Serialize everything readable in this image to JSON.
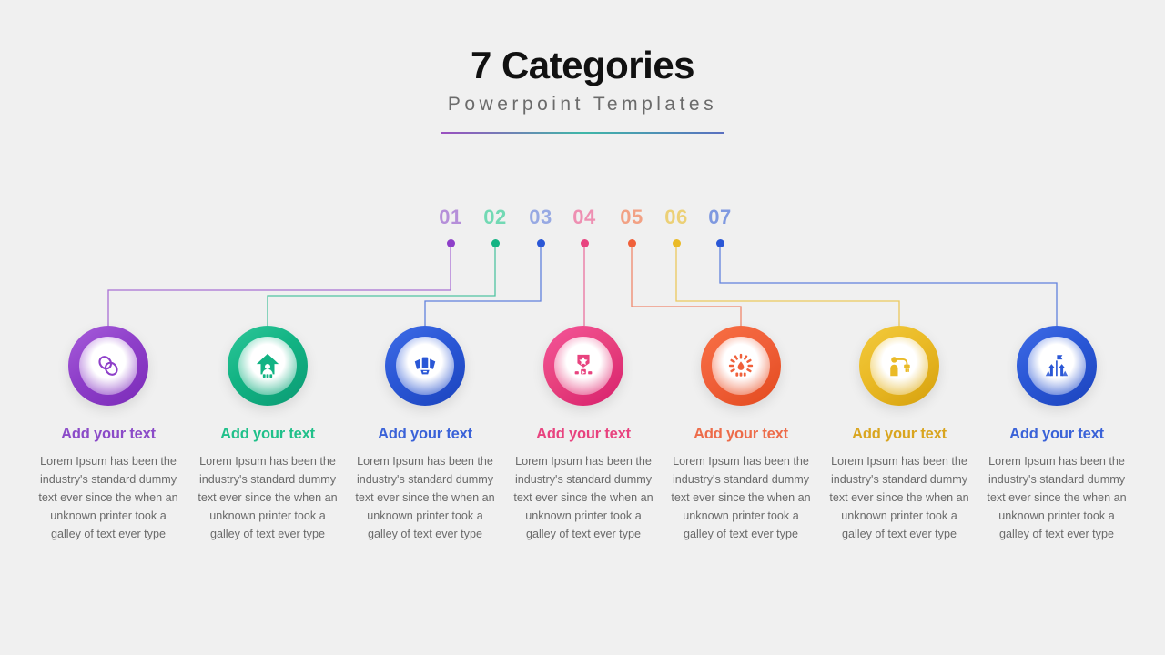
{
  "header": {
    "title": "7 Categories",
    "subtitle": "Powerpoint Templates",
    "rule_gradient": [
      "#9b4fc0",
      "#3fb7a8",
      "#5a6fc0"
    ]
  },
  "categories": [
    {
      "number": "01",
      "number_color": "#b58fd9",
      "accent": "#8e3fc9",
      "ring_light": "#a75ddb",
      "ring_dark": "#7b2bb8",
      "title": "Add your text",
      "title_color": "#8b4bc8",
      "body": "Lorem Ipsum has been the industry's standard dummy text ever since the when an unknown printer took a galley of text ever type",
      "icon": "chain-link-icon"
    },
    {
      "number": "02",
      "number_color": "#72d9b4",
      "accent": "#12b383",
      "ring_light": "#2ec79a",
      "ring_dark": "#0c9a74",
      "title": "Add your text",
      "title_color": "#20c08a",
      "body": "Lorem Ipsum has been the industry's standard dummy text ever since the when an unknown printer took a galley of text ever type",
      "icon": "home-family-icon"
    },
    {
      "number": "03",
      "number_color": "#97a9e3",
      "accent": "#2a57d6",
      "ring_light": "#3f6ce6",
      "ring_dark": "#1c44bd",
      "title": "Add your text",
      "title_color": "#3a62d8",
      "body": "Lorem Ipsum has been the industry's standard dummy text ever since the when an unknown printer took a galley of text ever type",
      "icon": "toolbox-icon"
    },
    {
      "number": "04",
      "number_color": "#ee8fb2",
      "accent": "#e8437f",
      "ring_light": "#f4549a",
      "ring_dark": "#d71f6d",
      "title": "Add your text",
      "title_color": "#e8437f",
      "body": "Lorem Ipsum has been the industry's standard dummy text ever since the when an unknown printer took a galley of text ever type",
      "icon": "award-badge-icon"
    },
    {
      "number": "05",
      "number_color": "#f2a184",
      "accent": "#f0603a",
      "ring_light": "#f87043",
      "ring_dark": "#e34a1d",
      "title": "Add your text",
      "title_color": "#ed6c4a",
      "body": "Lorem Ipsum has been the industry's standard dummy text ever since the when an unknown printer took a galley of text ever type",
      "icon": "gauge-icon"
    },
    {
      "number": "06",
      "number_color": "#ecd076",
      "accent": "#eaba26",
      "ring_light": "#f2ca3d",
      "ring_dark": "#d5a00d",
      "title": "Add your text",
      "title_color": "#d9a51f",
      "body": "Lorem Ipsum has been the industry's standard dummy text ever since the when an unknown printer took a galley of text ever type",
      "icon": "person-plug-icon"
    },
    {
      "number": "07",
      "number_color": "#7f99e0",
      "accent": "#2a57d6",
      "ring_light": "#3f6ce6",
      "ring_dark": "#1c44bd",
      "title": "Add your text",
      "title_color": "#3a62d8",
      "body": "Lorem Ipsum has been the industry's standard dummy text ever since the when an unknown printer took a galley of text ever type",
      "icon": "growth-flag-icon"
    }
  ]
}
